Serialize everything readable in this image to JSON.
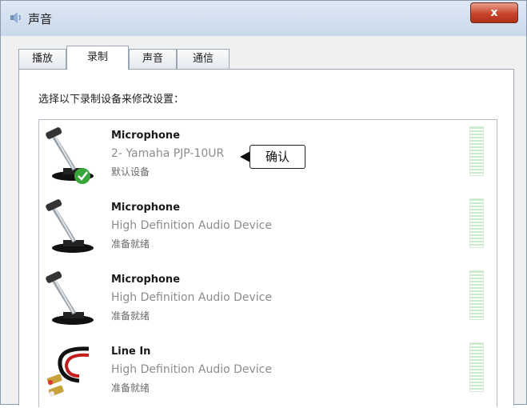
{
  "window": {
    "title": "声音",
    "close_label": "x"
  },
  "tabs": [
    {
      "label": "播放"
    },
    {
      "label": "录制"
    },
    {
      "label": "声音"
    },
    {
      "label": "通信"
    }
  ],
  "active_tab": 1,
  "instruction": "选择以下录制设备来修改设置：",
  "devices": [
    {
      "name": "Microphone",
      "description": "2- Yamaha PJP-10UR",
      "status": "默认设备",
      "icon": "microphone-icon",
      "is_default": true
    },
    {
      "name": "Microphone",
      "description": "High Definition Audio Device",
      "status": "准备就绪",
      "icon": "microphone-icon",
      "is_default": false
    },
    {
      "name": "Microphone",
      "description": "High Definition Audio Device",
      "status": "准备就绪",
      "icon": "microphone-icon",
      "is_default": false
    },
    {
      "name": "Line In",
      "description": "High Definition Audio Device",
      "status": "准备就绪",
      "icon": "line-in-cable-icon",
      "is_default": false
    }
  ],
  "annotation": {
    "text": "确认"
  },
  "colors": {
    "default_check": "#3aa63a",
    "meter": "#c9ecc9",
    "close_button": "#c8442c"
  }
}
